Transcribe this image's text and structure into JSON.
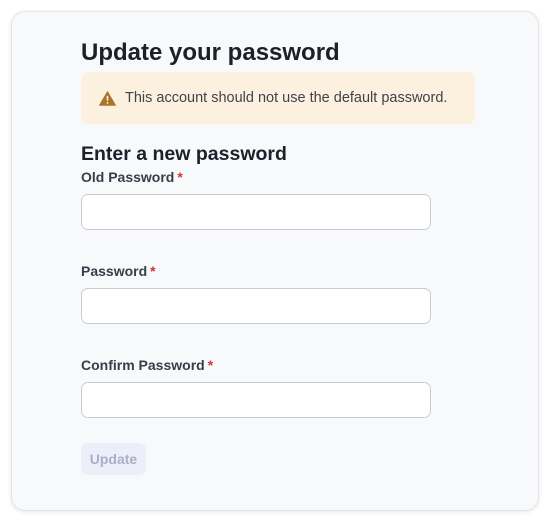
{
  "page": {
    "title": "Update your password"
  },
  "alert": {
    "icon": "warning-icon",
    "color": "#a8762a",
    "background": "#fcf1de",
    "message": "This account should not use the default password."
  },
  "form": {
    "section_title": "Enter a new password",
    "required_marker": "*",
    "fields": [
      {
        "label": "Old Password",
        "value": ""
      },
      {
        "label": "Password",
        "value": ""
      },
      {
        "label": "Confirm Password",
        "value": ""
      }
    ],
    "submit_label": "Update",
    "submit_enabled": false
  }
}
